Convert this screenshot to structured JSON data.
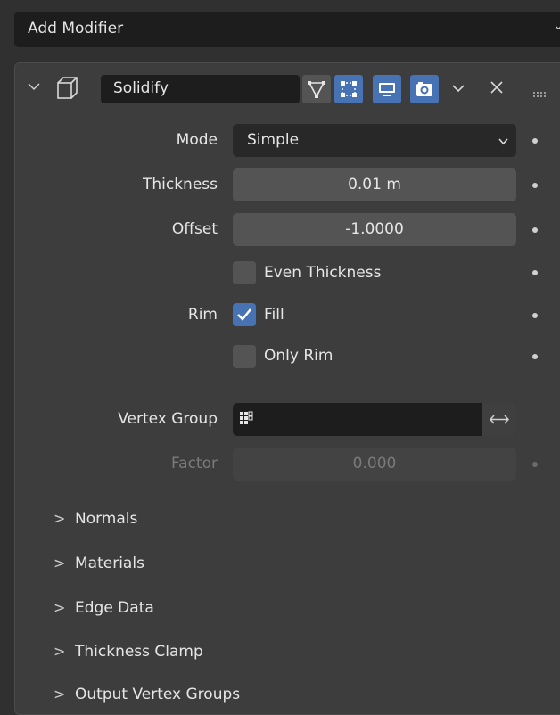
{
  "add_modifier": {
    "label": "Add Modifier"
  },
  "modifier": {
    "name": "Solidify",
    "props": {
      "mode_label": "Mode",
      "mode_value": "Simple",
      "thickness_label": "Thickness",
      "thickness_value": "0.01 m",
      "offset_label": "Offset",
      "offset_value": "-1.0000",
      "even_thickness": {
        "label": "Even Thickness",
        "checked": false
      },
      "rim_label": "Rim",
      "fill": {
        "label": "Fill",
        "checked": true
      },
      "only_rim": {
        "label": "Only Rim",
        "checked": false
      },
      "vertex_group_label": "Vertex Group",
      "vertex_group_value": "",
      "factor_label": "Factor",
      "factor_value": "0.000"
    },
    "subpanels": [
      "Normals",
      "Materials",
      "Edge Data",
      "Thickness Clamp",
      "Output Vertex Groups"
    ]
  },
  "colors": {
    "accent": "#4772b3",
    "panel": "#3d3d3d",
    "field": "#545454",
    "dark_field": "#1d1d1d"
  }
}
